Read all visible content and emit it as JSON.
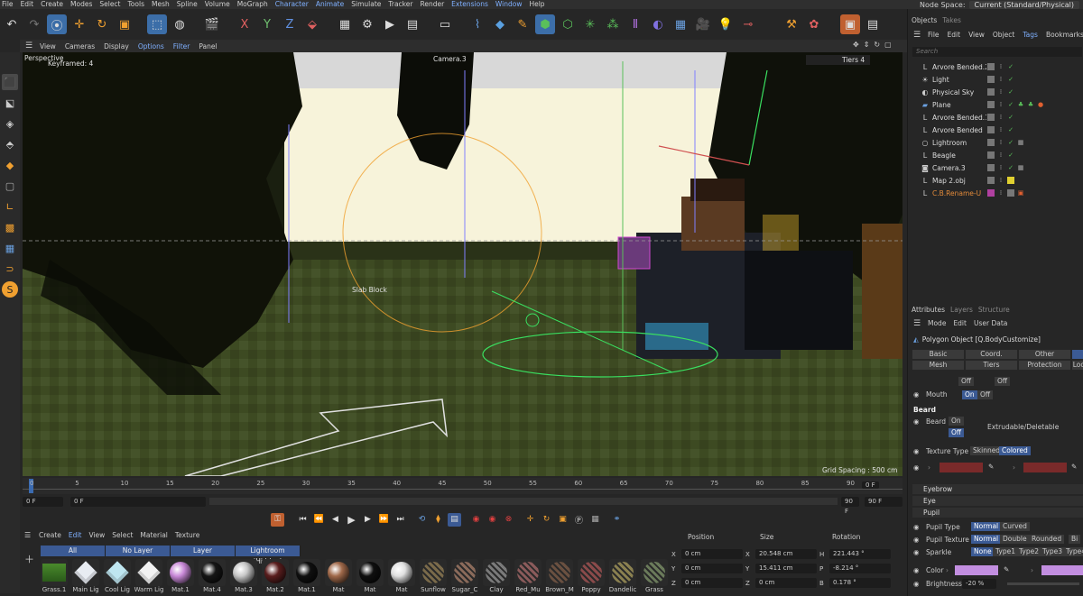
{
  "menubar": {
    "items": [
      "File",
      "Edit",
      "Create",
      "Modes",
      "Select",
      "Tools",
      "Mesh",
      "Spline",
      "Volume",
      "MoGraph",
      "Character",
      "Animate",
      "Simulate",
      "Tracker",
      "Render",
      "Extensions",
      "Window",
      "Help"
    ],
    "highlighted": [
      "Character",
      "Animate",
      "Extensions",
      "Window"
    ],
    "node_space_label": "Node Space:",
    "node_space_value": "Current (Standard/Physical)"
  },
  "viewport": {
    "menu": [
      "View",
      "Cameras",
      "Display",
      "Options",
      "Filter",
      "Panel"
    ],
    "menu_highlighted": [
      "Options",
      "Filter"
    ],
    "view_name": "Perspective",
    "keyframe_label": "Keyframed: 4",
    "camera_label": "Camera.3",
    "tiers_label": "Tiers 4",
    "object_label": "Slab Block",
    "grid_spacing": "Grid Spacing : 500 cm"
  },
  "timeline": {
    "ticks": [
      "0",
      "5",
      "10",
      "15",
      "20",
      "25",
      "30",
      "35",
      "40",
      "45",
      "50",
      "55",
      "60",
      "65",
      "70",
      "75",
      "80",
      "85",
      "90"
    ],
    "current_frame": "0 F",
    "start_frame": "0 F",
    "min_field": "0 F",
    "end_field": "90 F",
    "max_field": "90 F",
    "right_start": "0 F"
  },
  "materials": {
    "menu": [
      "Create",
      "Edit",
      "View",
      "Select",
      "Material",
      "Texture"
    ],
    "menu_highlighted": [
      "Edit"
    ],
    "layers": [
      "All",
      "No Layer",
      "Layer",
      "Lightroom (Hidden)"
    ],
    "items": [
      {
        "name": "Grass.1",
        "color": "#4a8a2c",
        "kind": "grass"
      },
      {
        "name": "Main Lig",
        "color": "#e8ecf2",
        "kind": "cube"
      },
      {
        "name": "Cool Lig",
        "color": "#bfe6f0",
        "kind": "cube"
      },
      {
        "name": "Warm Lig",
        "color": "#f2f2f2",
        "kind": "cube"
      },
      {
        "name": "Mat.1",
        "color": "#c989d8",
        "kind": "sphere"
      },
      {
        "name": "Mat.4",
        "color": "#151515",
        "kind": "sphere"
      },
      {
        "name": "Mat.3",
        "color": "#c8c8c8",
        "kind": "sphere"
      },
      {
        "name": "Mat.2",
        "color": "#5a1e1e",
        "kind": "sphere"
      },
      {
        "name": "Mat.1",
        "color": "#101010",
        "kind": "sphere"
      },
      {
        "name": "Mat",
        "color": "#a0694a",
        "kind": "sphere"
      },
      {
        "name": "Mat",
        "color": "#0f0f0f",
        "kind": "sphere"
      },
      {
        "name": "Mat",
        "color": "#e0e0e0",
        "kind": "sphere"
      },
      {
        "name": "Sunflow",
        "color": "#7a6a4a",
        "kind": "tex"
      },
      {
        "name": "Sugar_C",
        "color": "#8a6a5a",
        "kind": "tex"
      },
      {
        "name": "Clay",
        "color": "#7a7a7a",
        "kind": "tex"
      },
      {
        "name": "Red_Mu",
        "color": "#8a5a5a",
        "kind": "tex"
      },
      {
        "name": "Brown_M",
        "color": "#6a5040",
        "kind": "tex"
      },
      {
        "name": "Poppy",
        "color": "#8a4a4a",
        "kind": "tex"
      },
      {
        "name": "Dandelic",
        "color": "#8a8050",
        "kind": "tex"
      },
      {
        "name": "Grass",
        "color": "#6a7a5a",
        "kind": "tex"
      }
    ]
  },
  "coords": {
    "headers": [
      "Position",
      "Size",
      "Rotation"
    ],
    "rows": [
      {
        "a": "X",
        "pos": "0 cm",
        "s": "X",
        "size": "20.548 cm",
        "r": "H",
        "rot": "221.443 °"
      },
      {
        "a": "Y",
        "pos": "0 cm",
        "s": "Y",
        "size": "15.411 cm",
        "r": "P",
        "rot": "-8.214 °"
      },
      {
        "a": "Z",
        "pos": "0 cm",
        "s": "Z",
        "size": "0 cm",
        "r": "B",
        "rot": "0.178 °"
      }
    ]
  },
  "objects_panel": {
    "tabs": [
      "Objects",
      "Takes"
    ],
    "menu": [
      "File",
      "Edit",
      "View",
      "Object",
      "Tags",
      "Bookmarks"
    ],
    "menu_highlighted": [
      "Tags"
    ],
    "search_placeholder": "Search",
    "rows": [
      {
        "name": "Arvore Bended.2",
        "icon": "L",
        "color": "#ddd"
      },
      {
        "name": "Light",
        "icon": "☀",
        "color": "#ddd"
      },
      {
        "name": "Physical Sky",
        "icon": "◐",
        "color": "#ddd"
      },
      {
        "name": "Plane",
        "icon": "▰",
        "color": "#ddd"
      },
      {
        "name": "Arvore Bended.1",
        "icon": "L",
        "color": "#ddd"
      },
      {
        "name": "Arvore Bended",
        "icon": "L",
        "color": "#ddd"
      },
      {
        "name": "Lightroom",
        "icon": "○",
        "color": "#ddd"
      },
      {
        "name": "Beagle",
        "icon": "L",
        "color": "#ddd"
      },
      {
        "name": "Camera.3",
        "icon": "◙",
        "color": "#ddd"
      },
      {
        "name": "Map 2.obj",
        "icon": "L",
        "color": "#ddd"
      },
      {
        "name": "C.B.Rename-U",
        "icon": "L",
        "color": "#e28a3a"
      }
    ]
  },
  "attributes": {
    "tabs": [
      "Attributes",
      "Layers",
      "Structure"
    ],
    "menu": [
      "Mode",
      "Edit",
      "User Data"
    ],
    "title": "Polygon Object [Q.BodyCustomize]",
    "grid": [
      "Basic",
      "Coord.",
      "Other",
      "",
      "Mesh",
      "Tiers",
      "Protection",
      "Look"
    ],
    "off1": "Off",
    "off2": "Off",
    "mouth_label": "Mouth",
    "mouth_on": "On",
    "mouth_off": "Off",
    "beard_heading": "Beard",
    "beard_label": "Beard",
    "beard_on": "On",
    "beard_off": "Off",
    "beard_value": "Extrudable/Deletable",
    "texture_type_label": "Texture Type",
    "texture_skinned": "Skinned",
    "texture_colored": "Colored",
    "sections": [
      "Eyebrow",
      "Eye",
      "Pupil"
    ],
    "pupil_type_label": "Pupil Type",
    "pupil_type_normal": "Normal",
    "pupil_type_curved": "Curved",
    "pupil_texture_label": "Pupil Texture",
    "pupil_texture": [
      "Normal",
      "Double",
      "Rounded",
      "Bi"
    ],
    "sparkle_label": "Sparkle",
    "sparkle": [
      "None",
      "Type1",
      "Type2",
      "Type3",
      "Type4"
    ],
    "color_label": "Color",
    "brightness_label": "Brightness",
    "brightness_value": "-20 %",
    "swatch_color": "#c28ee0",
    "red_swatch": "#7a2a2a"
  }
}
